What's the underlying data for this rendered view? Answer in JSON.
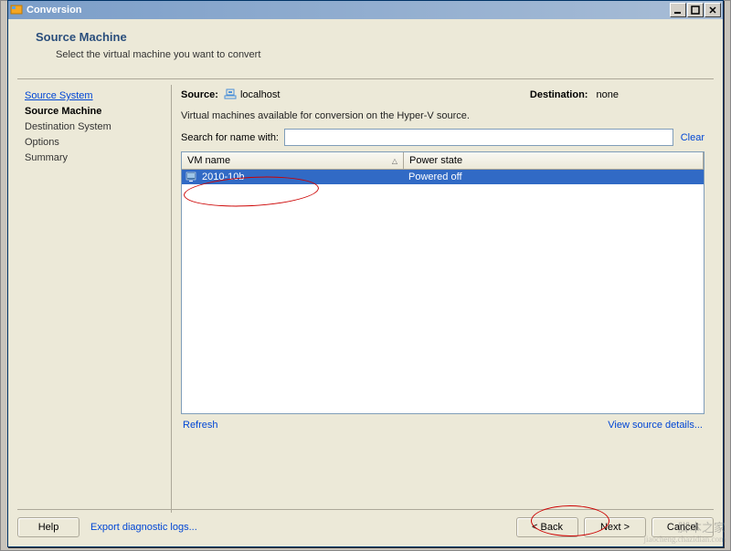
{
  "window": {
    "title": "Conversion"
  },
  "header": {
    "title": "Source Machine",
    "subtitle": "Select the virtual machine you want to convert"
  },
  "sidebar": {
    "items": [
      {
        "label": "Source System",
        "type": "link"
      },
      {
        "label": "Source Machine",
        "type": "current"
      },
      {
        "label": "Destination System",
        "type": "normal"
      },
      {
        "label": "Options",
        "type": "normal"
      },
      {
        "label": "Summary",
        "type": "normal"
      }
    ]
  },
  "content": {
    "source_label": "Source:",
    "source_value": "localhost",
    "destination_label": "Destination:",
    "destination_value": "none",
    "description": "Virtual machines available for conversion on the Hyper-V source.",
    "search_label": "Search for name with:",
    "search_value": "",
    "clear_label": "Clear",
    "columns": {
      "name": "VM name",
      "power": "Power state"
    },
    "rows": [
      {
        "name": "2010-10b",
        "power": "Powered off"
      }
    ],
    "refresh_label": "Refresh",
    "view_details_label": "View source details..."
  },
  "buttons": {
    "help": "Help",
    "export": "Export diagnostic logs...",
    "back": "< Back",
    "next": "Next >",
    "cancel": "Cancel"
  },
  "watermark": {
    "line1": "脚本之家",
    "line2": "jiaocheng.chazidian.com"
  }
}
